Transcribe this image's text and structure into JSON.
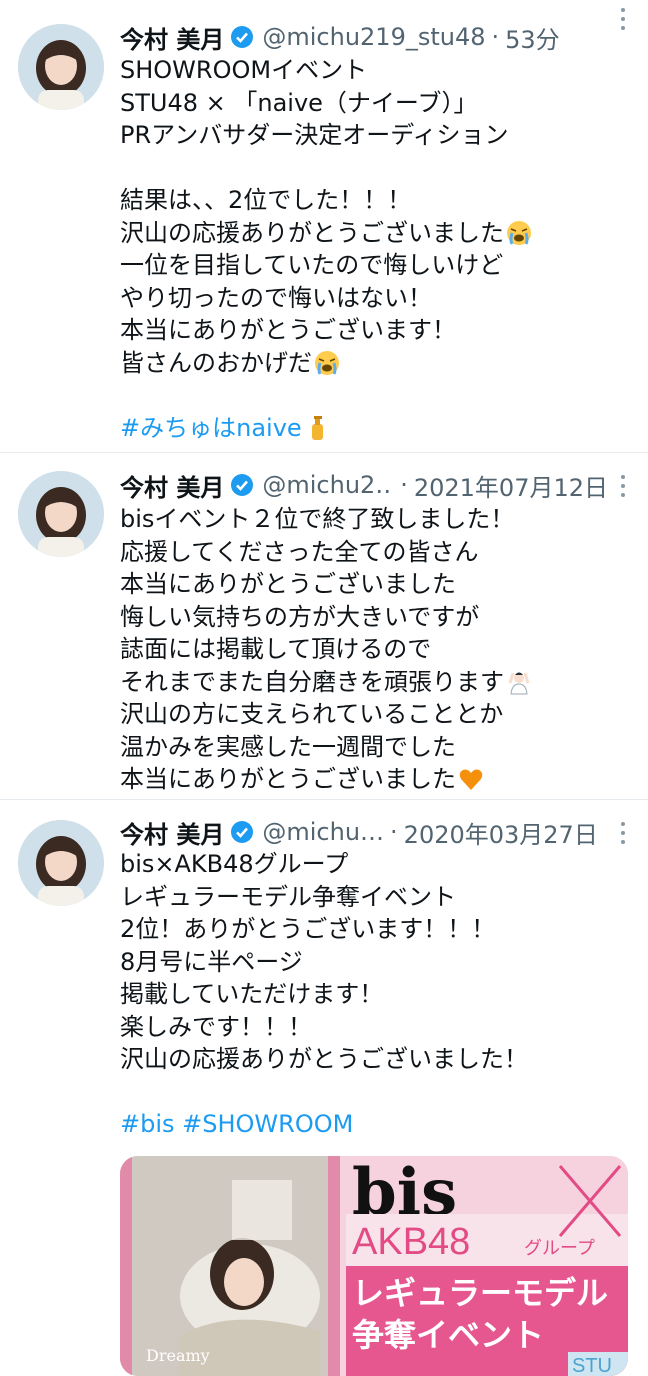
{
  "tweets": [
    {
      "author": "今村 美月",
      "handle": "@michu219_stu48",
      "time": "53分",
      "lines": [
        "SHOWROOMイベント",
        "STU48 × 「naive（ナイーブ）」",
        "PRアンバサダー決定オーディション",
        "",
        "結果は、、2位でした！！！",
        "沢山の応援ありがとうございました",
        "一位を目指していたので悔しいけど",
        "やり切ったので悔いはない！",
        "本当にありがとうございます！",
        "皆さんのおかげだ",
        ""
      ],
      "hashtags": "#みちゅはnaive"
    },
    {
      "author": "今村 美月",
      "handle": "@michu2…",
      "time": "2021年07月12日",
      "lines": [
        "bisイベント２位で終了致しました！",
        "応援してくださった全ての皆さん",
        "本当にありがとうございました",
        "悔しい気持ちの方が大きいですが",
        "誌面には掲載して頂けるので",
        "それまでまた自分磨きを頑張ります",
        "沢山の方に支えられていることとか",
        "温かみを実感した一週間でした",
        "本当にありがとうございました"
      ]
    },
    {
      "author": "今村 美月",
      "handle": "@michu…",
      "time": "2020年03月27日",
      "lines": [
        "bis×AKB48グループ",
        "レギュラーモデル争奪イベント",
        "2位！ありがとうございます！！！",
        "8月号に半ページ",
        "掲載していただけます！",
        "楽しみです！！！",
        "沢山の応援ありがとうございました！",
        ""
      ],
      "hashtags": "#bis #SHOWROOM",
      "media": {
        "magazine_logo": "bis",
        "title_1": "AKB48",
        "title_1_sub": "グループ",
        "title_2": "レギュラーモデル",
        "title_3": "争奪イベント",
        "corner_text": "STU",
        "cover_text": "Dreamy"
      }
    }
  ],
  "colors": {
    "link": "#1d9bf0",
    "verified": "#1d9bf0",
    "muted": "#536471",
    "divider": "#e6ecf0"
  },
  "icons": [
    "verified-badge-icon",
    "more-icon",
    "crying-emoji-icon",
    "person-raising-hand-emoji-icon",
    "orange-heart-emoji-icon",
    "lotion-bottle-emoji-icon"
  ]
}
